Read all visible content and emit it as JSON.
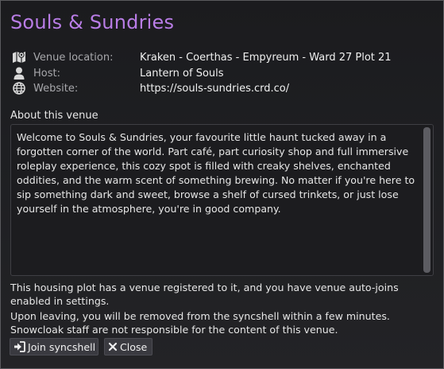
{
  "venue": {
    "title": "Souls & Sundries"
  },
  "info": {
    "location_label": "Venue location:",
    "location_value": "Kraken - Coerthas - Empyreum - Ward 27 Plot 21",
    "host_label": "Host:",
    "host_value": "Lantern of Souls",
    "website_label": "Website:",
    "website_value": "https://souls-sundries.crd.co/"
  },
  "about": {
    "label": "About this venue",
    "description": "Welcome to Souls & Sundries, your favourite little haunt tucked away in a forgotten corner of the world. Part café, part curiosity shop and full immersive roleplay experience, this cozy spot is filled with creaky shelves, enchanted oddities, and the warm scent of something brewing. No matter if you're here to sip something dark and sweet, browse a shelf of cursed trinkets, or just lose yourself in the atmosphere, you're in good company."
  },
  "notices": {
    "autojoin": "This housing plot has a venue registered to it, and you have venue auto-joins enabled in settings.",
    "leaving": "Upon leaving, you will be removed from the syncshell within a few minutes. Snowcloak staff are not responsible for the content of this venue."
  },
  "buttons": {
    "join_label": "Join syncshell",
    "close_label": "Close"
  },
  "icons": {
    "location": "map-icon",
    "host": "user-icon",
    "website": "globe-icon",
    "join": "sign-in-icon",
    "close": "close-icon"
  },
  "colors": {
    "title": "#b97de6",
    "label": "#a7a7ab",
    "background": "#1e1f22",
    "button": "#3a3a40"
  }
}
